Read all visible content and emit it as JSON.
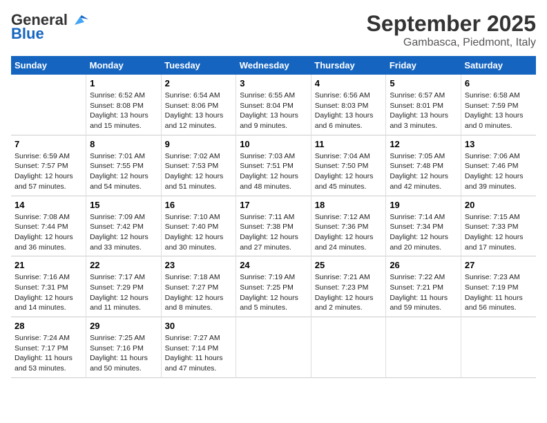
{
  "logo": {
    "text_general": "General",
    "text_blue": "Blue"
  },
  "header": {
    "month": "September 2025",
    "location": "Gambasca, Piedmont, Italy"
  },
  "days_of_week": [
    "Sunday",
    "Monday",
    "Tuesday",
    "Wednesday",
    "Thursday",
    "Friday",
    "Saturday"
  ],
  "weeks": [
    [
      {
        "day": "",
        "sunrise": "",
        "sunset": "",
        "daylight": ""
      },
      {
        "day": "1",
        "sunrise": "Sunrise: 6:52 AM",
        "sunset": "Sunset: 8:08 PM",
        "daylight": "Daylight: 13 hours and 15 minutes."
      },
      {
        "day": "2",
        "sunrise": "Sunrise: 6:54 AM",
        "sunset": "Sunset: 8:06 PM",
        "daylight": "Daylight: 13 hours and 12 minutes."
      },
      {
        "day": "3",
        "sunrise": "Sunrise: 6:55 AM",
        "sunset": "Sunset: 8:04 PM",
        "daylight": "Daylight: 13 hours and 9 minutes."
      },
      {
        "day": "4",
        "sunrise": "Sunrise: 6:56 AM",
        "sunset": "Sunset: 8:03 PM",
        "daylight": "Daylight: 13 hours and 6 minutes."
      },
      {
        "day": "5",
        "sunrise": "Sunrise: 6:57 AM",
        "sunset": "Sunset: 8:01 PM",
        "daylight": "Daylight: 13 hours and 3 minutes."
      },
      {
        "day": "6",
        "sunrise": "Sunrise: 6:58 AM",
        "sunset": "Sunset: 7:59 PM",
        "daylight": "Daylight: 13 hours and 0 minutes."
      }
    ],
    [
      {
        "day": "7",
        "sunrise": "Sunrise: 6:59 AM",
        "sunset": "Sunset: 7:57 PM",
        "daylight": "Daylight: 12 hours and 57 minutes."
      },
      {
        "day": "8",
        "sunrise": "Sunrise: 7:01 AM",
        "sunset": "Sunset: 7:55 PM",
        "daylight": "Daylight: 12 hours and 54 minutes."
      },
      {
        "day": "9",
        "sunrise": "Sunrise: 7:02 AM",
        "sunset": "Sunset: 7:53 PM",
        "daylight": "Daylight: 12 hours and 51 minutes."
      },
      {
        "day": "10",
        "sunrise": "Sunrise: 7:03 AM",
        "sunset": "Sunset: 7:51 PM",
        "daylight": "Daylight: 12 hours and 48 minutes."
      },
      {
        "day": "11",
        "sunrise": "Sunrise: 7:04 AM",
        "sunset": "Sunset: 7:50 PM",
        "daylight": "Daylight: 12 hours and 45 minutes."
      },
      {
        "day": "12",
        "sunrise": "Sunrise: 7:05 AM",
        "sunset": "Sunset: 7:48 PM",
        "daylight": "Daylight: 12 hours and 42 minutes."
      },
      {
        "day": "13",
        "sunrise": "Sunrise: 7:06 AM",
        "sunset": "Sunset: 7:46 PM",
        "daylight": "Daylight: 12 hours and 39 minutes."
      }
    ],
    [
      {
        "day": "14",
        "sunrise": "Sunrise: 7:08 AM",
        "sunset": "Sunset: 7:44 PM",
        "daylight": "Daylight: 12 hours and 36 minutes."
      },
      {
        "day": "15",
        "sunrise": "Sunrise: 7:09 AM",
        "sunset": "Sunset: 7:42 PM",
        "daylight": "Daylight: 12 hours and 33 minutes."
      },
      {
        "day": "16",
        "sunrise": "Sunrise: 7:10 AM",
        "sunset": "Sunset: 7:40 PM",
        "daylight": "Daylight: 12 hours and 30 minutes."
      },
      {
        "day": "17",
        "sunrise": "Sunrise: 7:11 AM",
        "sunset": "Sunset: 7:38 PM",
        "daylight": "Daylight: 12 hours and 27 minutes."
      },
      {
        "day": "18",
        "sunrise": "Sunrise: 7:12 AM",
        "sunset": "Sunset: 7:36 PM",
        "daylight": "Daylight: 12 hours and 24 minutes."
      },
      {
        "day": "19",
        "sunrise": "Sunrise: 7:14 AM",
        "sunset": "Sunset: 7:34 PM",
        "daylight": "Daylight: 12 hours and 20 minutes."
      },
      {
        "day": "20",
        "sunrise": "Sunrise: 7:15 AM",
        "sunset": "Sunset: 7:33 PM",
        "daylight": "Daylight: 12 hours and 17 minutes."
      }
    ],
    [
      {
        "day": "21",
        "sunrise": "Sunrise: 7:16 AM",
        "sunset": "Sunset: 7:31 PM",
        "daylight": "Daylight: 12 hours and 14 minutes."
      },
      {
        "day": "22",
        "sunrise": "Sunrise: 7:17 AM",
        "sunset": "Sunset: 7:29 PM",
        "daylight": "Daylight: 12 hours and 11 minutes."
      },
      {
        "day": "23",
        "sunrise": "Sunrise: 7:18 AM",
        "sunset": "Sunset: 7:27 PM",
        "daylight": "Daylight: 12 hours and 8 minutes."
      },
      {
        "day": "24",
        "sunrise": "Sunrise: 7:19 AM",
        "sunset": "Sunset: 7:25 PM",
        "daylight": "Daylight: 12 hours and 5 minutes."
      },
      {
        "day": "25",
        "sunrise": "Sunrise: 7:21 AM",
        "sunset": "Sunset: 7:23 PM",
        "daylight": "Daylight: 12 hours and 2 minutes."
      },
      {
        "day": "26",
        "sunrise": "Sunrise: 7:22 AM",
        "sunset": "Sunset: 7:21 PM",
        "daylight": "Daylight: 11 hours and 59 minutes."
      },
      {
        "day": "27",
        "sunrise": "Sunrise: 7:23 AM",
        "sunset": "Sunset: 7:19 PM",
        "daylight": "Daylight: 11 hours and 56 minutes."
      }
    ],
    [
      {
        "day": "28",
        "sunrise": "Sunrise: 7:24 AM",
        "sunset": "Sunset: 7:17 PM",
        "daylight": "Daylight: 11 hours and 53 minutes."
      },
      {
        "day": "29",
        "sunrise": "Sunrise: 7:25 AM",
        "sunset": "Sunset: 7:16 PM",
        "daylight": "Daylight: 11 hours and 50 minutes."
      },
      {
        "day": "30",
        "sunrise": "Sunrise: 7:27 AM",
        "sunset": "Sunset: 7:14 PM",
        "daylight": "Daylight: 11 hours and 47 minutes."
      },
      {
        "day": "",
        "sunrise": "",
        "sunset": "",
        "daylight": ""
      },
      {
        "day": "",
        "sunrise": "",
        "sunset": "",
        "daylight": ""
      },
      {
        "day": "",
        "sunrise": "",
        "sunset": "",
        "daylight": ""
      },
      {
        "day": "",
        "sunrise": "",
        "sunset": "",
        "daylight": ""
      }
    ]
  ]
}
